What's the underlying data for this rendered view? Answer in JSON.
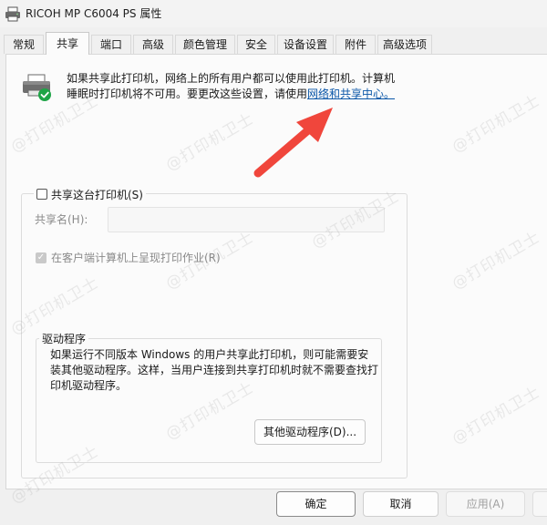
{
  "window": {
    "title": "RICOH MP C6004 PS 属性"
  },
  "tabs": [
    {
      "label": "常规"
    },
    {
      "label": "共享"
    },
    {
      "label": "端口"
    },
    {
      "label": "高级"
    },
    {
      "label": "颜色管理"
    },
    {
      "label": "安全"
    },
    {
      "label": "设备设置"
    },
    {
      "label": "附件"
    },
    {
      "label": "高级选项"
    }
  ],
  "active_tab": "共享",
  "info": {
    "line1": "如果共享此打印机，网络上的所有用户都可以使用此打印机。计算机",
    "line2_prefix": "睡眠时打印机将不可用。要更改这些设置，请使用",
    "link": "网络和共享中心。"
  },
  "share": {
    "checkbox_label": "共享这台打印机(S)",
    "checked": false,
    "share_name_label": "共享名(H):",
    "share_name_value": "",
    "render_jobs_label": "在客户端计算机上呈现打印作业(R)",
    "render_jobs_checked": true
  },
  "drivers": {
    "legend": "驱动程序",
    "description": "如果运行不同版本 Windows 的用户共享此打印机，则可能需要安装其他驱动程序。这样，当用户连接到共享打印机时就不需要查找打印机驱动程序。",
    "other_drivers_button": "其他驱动程序(D)..."
  },
  "footer": {
    "ok": "确定",
    "cancel": "取消",
    "apply": "应用(A)"
  },
  "watermark_text": "@打印机卫士",
  "colors": {
    "link": "#0b57a8",
    "annotation_arrow": "#f0463c",
    "check_green": "#1ea446"
  },
  "icons": {
    "title": "printer-icon",
    "info": "printer-shared-icon",
    "annotation": "red-arrow-icon"
  }
}
